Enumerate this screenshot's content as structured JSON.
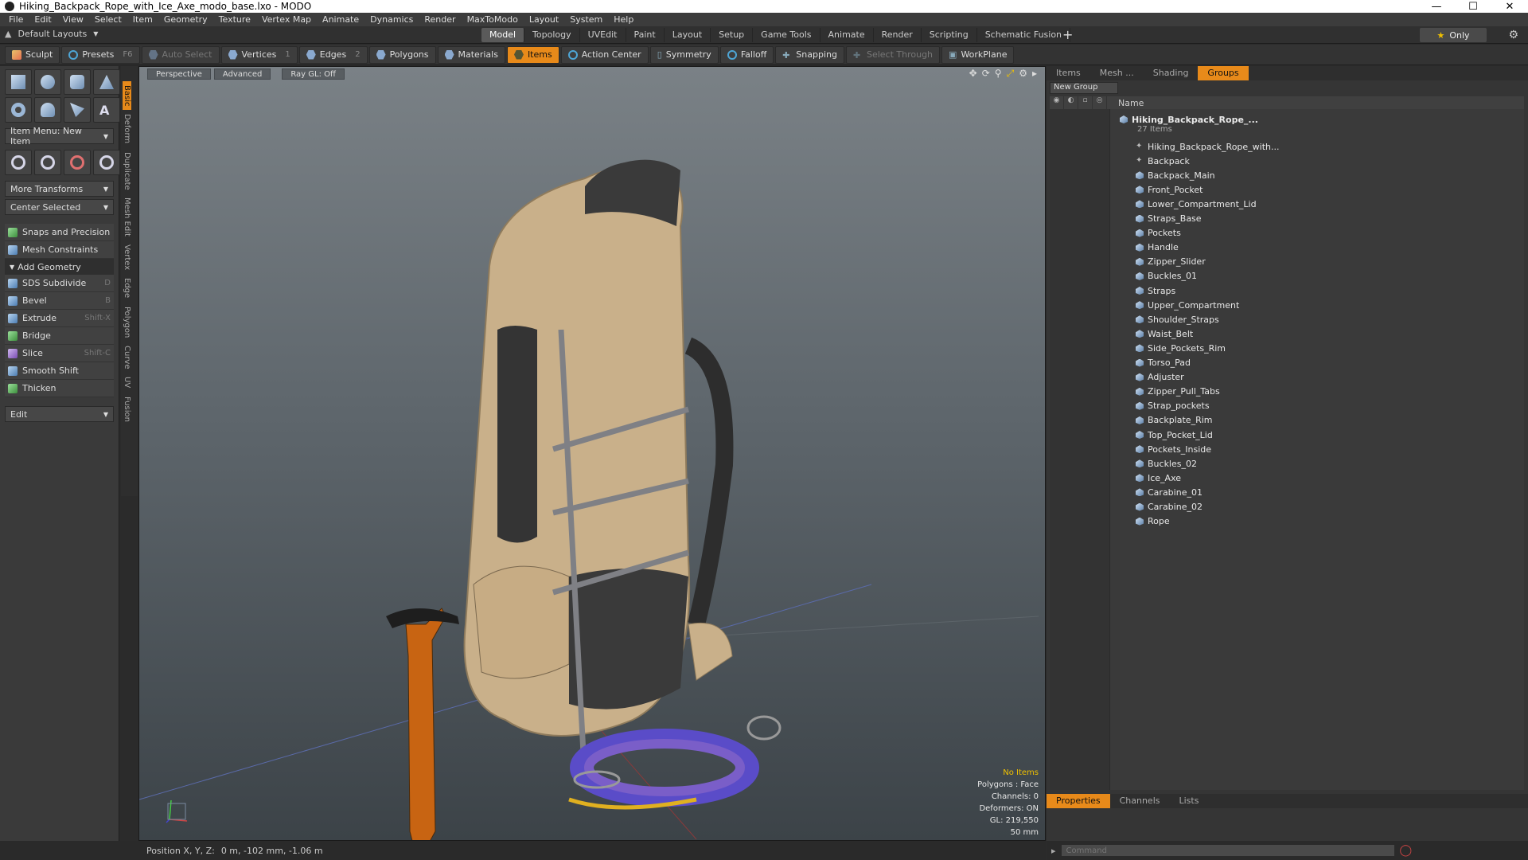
{
  "window": {
    "title": "Hiking_Backpack_Rope_with_Ice_Axe_modo_base.lxo - MODO"
  },
  "menu": [
    "File",
    "Edit",
    "View",
    "Select",
    "Item",
    "Geometry",
    "Texture",
    "Vertex Map",
    "Animate",
    "Dynamics",
    "Render",
    "MaxToModo",
    "Layout",
    "System",
    "Help"
  ],
  "layout_bar": {
    "layouts_label": "Default Layouts",
    "tabs": [
      "Model",
      "Topology",
      "UVEdit",
      "Paint",
      "Layout",
      "Setup",
      "Game Tools",
      "Animate",
      "Render",
      "Scripting",
      "Schematic Fusion"
    ],
    "active_tab": "Model",
    "only_label": "Only"
  },
  "toolbar": {
    "sculpt": "Sculpt",
    "presets": "Presets",
    "presets_shortcut": "F6",
    "auto_select": "Auto Select",
    "vertices": "Vertices",
    "vertices_key": "1",
    "edges": "Edges",
    "edges_key": "2",
    "polygons": "Polygons",
    "materials": "Materials",
    "items": "Items",
    "action_center": "Action Center",
    "symmetry": "Symmetry",
    "falloff": "Falloff",
    "snapping": "Snapping",
    "select_through": "Select Through",
    "workplane": "WorkPlane"
  },
  "left_panel": {
    "item_menu": "Item Menu: New Item",
    "more_transforms": "More Transforms",
    "center_selected": "Center Selected",
    "snaps": "Snaps and Precision",
    "mesh_constraints": "Mesh Constraints",
    "add_geometry": "Add Geometry",
    "tools": [
      {
        "label": "SDS Subdivide",
        "shortcut": "D"
      },
      {
        "label": "Bevel",
        "shortcut": "B"
      },
      {
        "label": "Extrude",
        "shortcut": "Shift-X"
      },
      {
        "label": "Bridge",
        "shortcut": ""
      },
      {
        "label": "Slice",
        "shortcut": "Shift-C"
      },
      {
        "label": "Smooth Shift",
        "shortcut": ""
      },
      {
        "label": "Thicken",
        "shortcut": ""
      }
    ],
    "edit_dropdown": "Edit",
    "vertical_tabs": [
      "Basic",
      "Deform",
      "Duplicate",
      "Mesh Edit",
      "Vertex",
      "Edge",
      "Polygon",
      "Curve",
      "UV",
      "Fusion"
    ]
  },
  "viewport": {
    "buttons": [
      "Perspective",
      "Advanced",
      "Ray GL: Off"
    ],
    "info": {
      "no_items": "No Items",
      "polygons": "Polygons : Face",
      "channels": "Channels: 0",
      "deformers": "Deformers: ON",
      "gl": "GL: 219,550",
      "scale": "50 mm"
    }
  },
  "right_panel": {
    "tabs": [
      "Items",
      "Mesh ...",
      "Shading",
      "Groups"
    ],
    "active_tab": "Groups",
    "new_group": "New Group",
    "name_header": "Name",
    "root": "Hiking_Backpack_Rope_...",
    "root_count": "27 Items",
    "items": [
      "Hiking_Backpack_Rope_with...",
      "Backpack",
      "Backpack_Main",
      "Front_Pocket",
      "Lower_Compartment_Lid",
      "Straps_Base",
      "Pockets",
      "Handle",
      "Zipper_Slider",
      "Buckles_01",
      "Straps",
      "Upper_Compartment",
      "Shoulder_Straps",
      "Waist_Belt",
      "Side_Pockets_Rim",
      "Torso_Pad",
      "Adjuster",
      "Zipper_Pull_Tabs",
      "Strap_pockets",
      "Backplate_Rim",
      "Top_Pocket_Lid",
      "Pockets_Inside",
      "Buckles_02",
      "Ice_Axe",
      "Carabine_01",
      "Carabine_02",
      "Rope"
    ],
    "prop_tabs": [
      "Properties",
      "Channels",
      "Lists"
    ],
    "active_prop_tab": "Properties"
  },
  "status": {
    "position_label": "Position X, Y, Z:",
    "position_value": "0 m, -102 mm, -1.06 m",
    "command_placeholder": "Command"
  },
  "colors": {
    "accent": "#e88a1a",
    "info_highlight": "#f0c000"
  }
}
